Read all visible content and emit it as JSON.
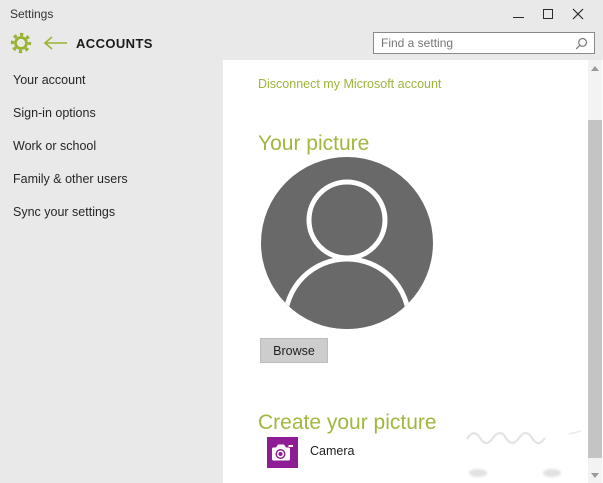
{
  "window": {
    "title": "Settings"
  },
  "header": {
    "page_title": "ACCOUNTS"
  },
  "search": {
    "placeholder": "Find a setting"
  },
  "sidebar": {
    "items": [
      {
        "label": "Your account"
      },
      {
        "label": "Sign-in options"
      },
      {
        "label": "Work or school"
      },
      {
        "label": "Family & other users"
      },
      {
        "label": "Sync your settings"
      }
    ]
  },
  "content": {
    "disconnect_link": "Disconnect my Microsoft account",
    "sections": [
      {
        "heading": "Your picture"
      },
      {
        "heading": "Create your picture"
      }
    ],
    "browse_button": "Browse",
    "camera_label": "Camera"
  },
  "icons": {
    "titlebar": [
      "minimize-icon",
      "maximize-icon",
      "close-icon"
    ],
    "header": [
      "gear-icon",
      "back-arrow-icon"
    ],
    "search": "search-icon",
    "avatar": "user-silhouette-icon",
    "camera_tile": "camera-icon",
    "scrollbar": [
      "scroll-up-arrow-icon",
      "scroll-down-arrow-icon"
    ]
  },
  "colors": {
    "accent_green_icons": "#99b433",
    "accent_green_text": "#9cb53a",
    "camera_purple": "#8e1d95",
    "avatar_gray": "#696969",
    "chrome_gray": "#e9e9e9"
  }
}
